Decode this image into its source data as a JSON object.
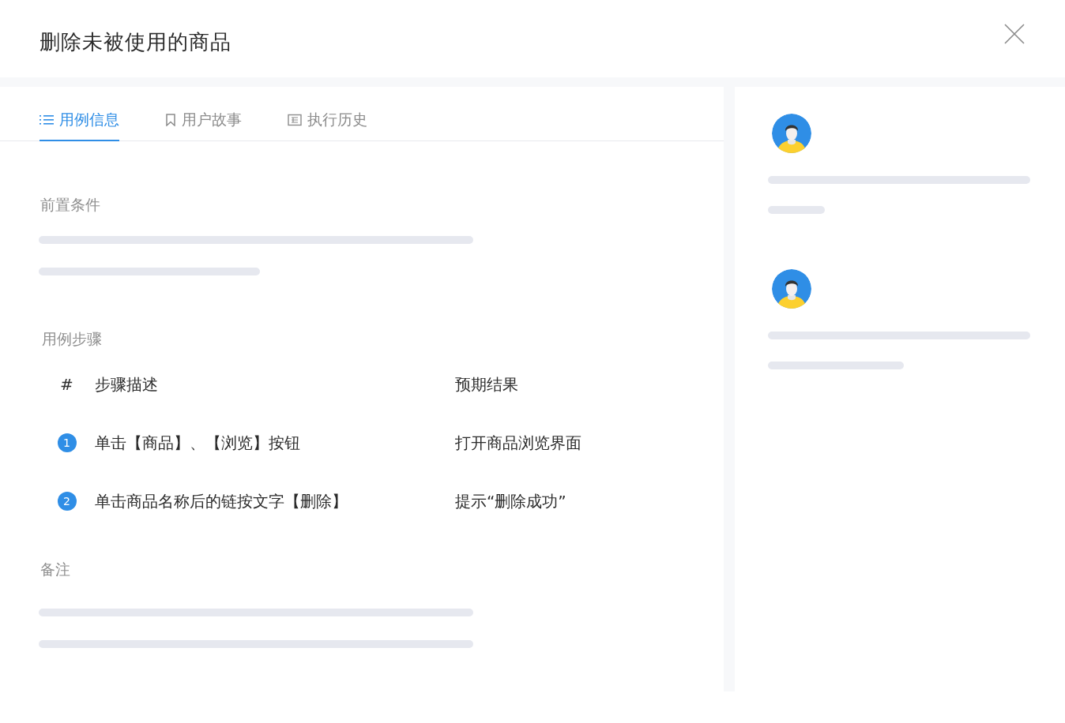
{
  "dialog": {
    "title": "删除未被使用的商品"
  },
  "tabs": [
    {
      "label": "用例信息",
      "selected": true
    },
    {
      "label": "用户故事",
      "selected": false
    },
    {
      "label": "执行历史",
      "selected": false
    }
  ],
  "sections": {
    "precondition": "前置条件",
    "steps": "用例步骤",
    "notes": "备注"
  },
  "steps_table": {
    "columns": [
      "#",
      "步骤描述",
      "预期结果"
    ],
    "rows": [
      {
        "number": "1",
        "description": "单击【商品】、【浏览】按钮",
        "expected": "打开商品浏览界面"
      },
      {
        "number": "2",
        "description": "单击商品名称后的链按文字【删除】",
        "expected": "提示“删除成功”"
      }
    ]
  }
}
